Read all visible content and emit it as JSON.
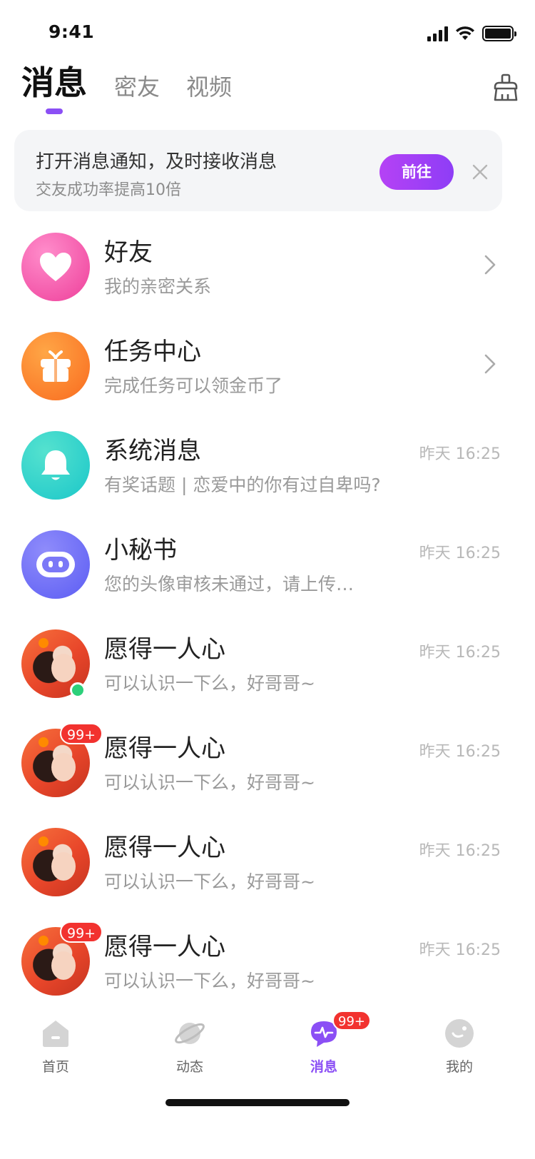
{
  "status_bar": {
    "time": "9:41"
  },
  "top_tabs": [
    {
      "label": "消息",
      "active": true
    },
    {
      "label": "密友",
      "active": false
    },
    {
      "label": "视频",
      "active": false
    }
  ],
  "notice": {
    "title": "打开消息通知，及时接收消息",
    "subtitle": "交友成功率提高10倍",
    "button_label": "前往"
  },
  "conversations": [
    {
      "title": "好友",
      "subtitle": "我的亲密关系",
      "avatar_icon": "heart-icon",
      "avatar_color": "#f25ca8"
    },
    {
      "title": "任务中心",
      "subtitle": "完成任务可以领金币了",
      "avatar_icon": "gift-icon",
      "avatar_color": "#fb7d27"
    },
    {
      "title": "系统消息",
      "subtitle": "有奖话题 | 恋爱中的你有过自卑吗?",
      "time": "昨天 16:25",
      "avatar_icon": "bell-icon",
      "avatar_color": "#2cd3c0"
    },
    {
      "title": "小秘书",
      "subtitle": "您的头像审核未通过，请上传…",
      "time": "昨天 16:25",
      "avatar_icon": "robot-icon",
      "avatar_color": "#6a68f6"
    },
    {
      "title": "愿得一人心",
      "subtitle": "可以认识一下么，好哥哥~",
      "time": "昨天 16:25",
      "online": true
    },
    {
      "title": "愿得一人心",
      "subtitle": "可以认识一下么，好哥哥~",
      "time": "昨天 16:25",
      "badge": "99+"
    },
    {
      "title": "愿得一人心",
      "subtitle": "可以认识一下么，好哥哥~",
      "time": "昨天 16:25"
    },
    {
      "title": "愿得一人心",
      "subtitle": "可以认识一下么，好哥哥~",
      "time": "昨天 16:25",
      "badge": "99+"
    }
  ],
  "bottom_nav": [
    {
      "label": "首页",
      "icon": "home-icon"
    },
    {
      "label": "动态",
      "icon": "planet-icon"
    },
    {
      "label": "消息",
      "icon": "message-icon",
      "active": true,
      "badge": "99+"
    },
    {
      "label": "我的",
      "icon": "profile-icon"
    }
  ],
  "colors": {
    "accent": "#8b4ff5",
    "badge": "#f2322f",
    "online": "#2cd07a"
  }
}
